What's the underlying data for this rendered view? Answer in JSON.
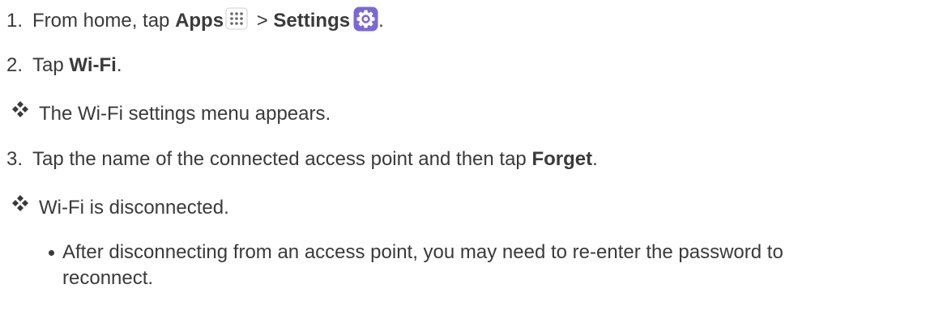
{
  "steps": [
    {
      "number": "1.",
      "prefix": "From home, tap ",
      "apps_label": "Apps",
      "separator": " > ",
      "settings_label": "Settings",
      "suffix": "."
    },
    {
      "number": "2.",
      "prefix": "Tap ",
      "wifi_label": "Wi-Fi",
      "suffix": "."
    },
    {
      "number": "3.",
      "prefix": "Tap the name of the connected access point and then tap ",
      "forget_label": "Forget",
      "suffix": "."
    }
  ],
  "results": {
    "menu_appears": "The Wi-Fi settings menu appears.",
    "disconnected": "Wi-Fi is disconnected."
  },
  "note": {
    "line1": "After disconnecting from an access point, you may need to re-enter the password to",
    "line2": "reconnect."
  },
  "colors": {
    "text": "#3a3a3a",
    "settings_icon": "#7b68d6"
  },
  "icons": {
    "apps": "apps-grid-icon",
    "settings": "settings-gear-icon",
    "result_bullet": "diamond-bullet-icon",
    "note_bullet": "dot-bullet-icon"
  }
}
